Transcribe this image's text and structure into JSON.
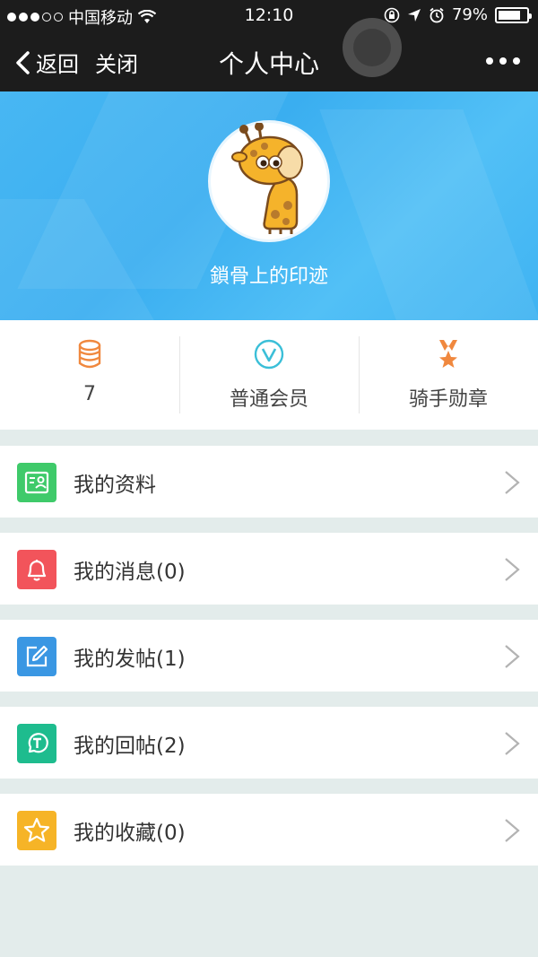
{
  "status_bar": {
    "carrier": "中国移动",
    "time": "12:10",
    "battery": "79%",
    "battery_level": 0.79,
    "signal_bars": 3
  },
  "nav": {
    "back_label": "返回",
    "close_label": "关闭",
    "title": "个人中心"
  },
  "profile": {
    "username": "鎖骨上的印迹"
  },
  "stats": [
    {
      "label": "7",
      "icon": "coins-icon",
      "color": "#f0883e"
    },
    {
      "label": "普通会员",
      "icon": "vip-icon",
      "color": "#3bbfd8"
    },
    {
      "label": "骑手勋章",
      "icon": "medal-icon",
      "color": "#f0883e"
    }
  ],
  "menu": [
    {
      "label": "我的资料",
      "icon": "profile-card-icon",
      "color": "#3fca6a"
    },
    {
      "label": "我的消息(0)",
      "icon": "bell-icon",
      "color": "#f2545b"
    },
    {
      "label": "我的发帖(1)",
      "icon": "edit-icon",
      "color": "#3a97e3"
    },
    {
      "label": "我的回帖(2)",
      "icon": "reply-icon",
      "color": "#1ebc8e"
    },
    {
      "label": "我的收藏(0)",
      "icon": "star-icon",
      "color": "#f6b427"
    }
  ]
}
